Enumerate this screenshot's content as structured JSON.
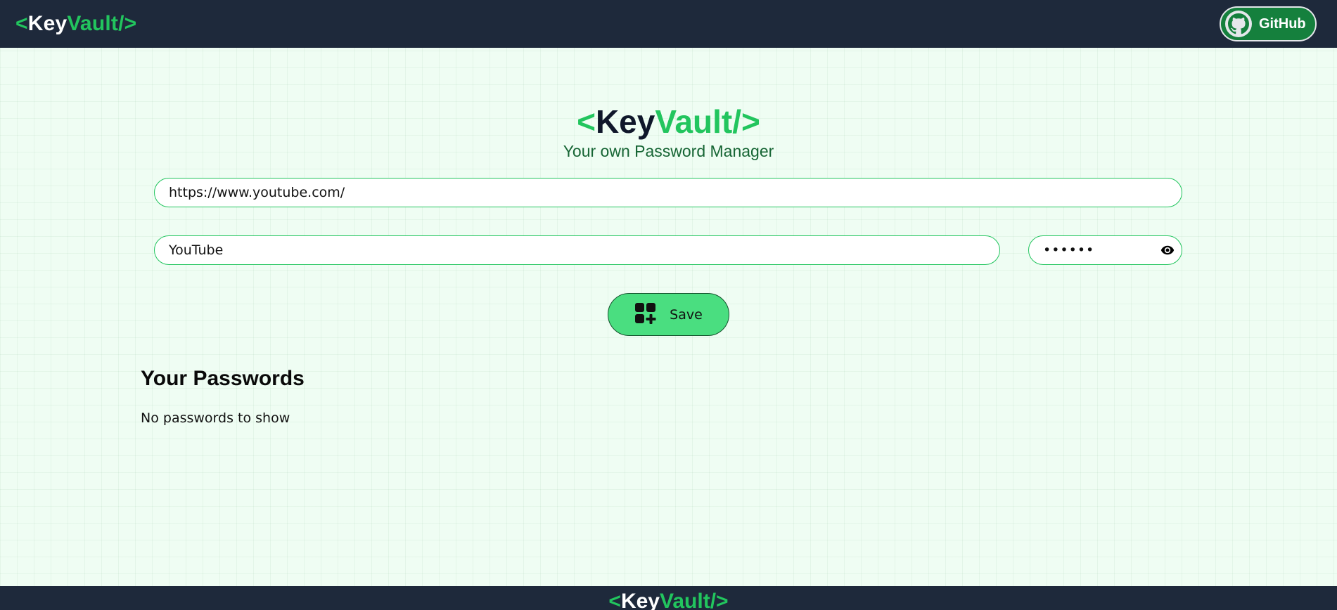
{
  "nav": {
    "logo": {
      "open": "<",
      "key": "Key",
      "vault": "Vault/",
      "close": ">"
    },
    "github_label": "GitHub"
  },
  "hero": {
    "logo": {
      "open": "<",
      "key": "Key",
      "vault": "Vault/",
      "close": ">"
    },
    "tagline": "Your own Password Manager"
  },
  "form": {
    "site_value": "https://www.youtube.com/",
    "username_value": "YouTube",
    "password_value": "abcdef",
    "save_label": "Save"
  },
  "passwords": {
    "title": "Your Passwords",
    "empty_message": "No passwords to show"
  },
  "footer": {
    "logo": {
      "open": "<",
      "key": "Key",
      "vault": "Vault/",
      "close": ">"
    }
  },
  "colors": {
    "navbar_bg": "#1e293b",
    "accent": "#22c55e",
    "page_bg": "#effdf3",
    "save_button_bg": "#4ade80",
    "github_button_bg": "#15803d"
  },
  "icons": {
    "github": "github-icon",
    "eye": "eye-icon",
    "save": "add-grid-icon"
  }
}
